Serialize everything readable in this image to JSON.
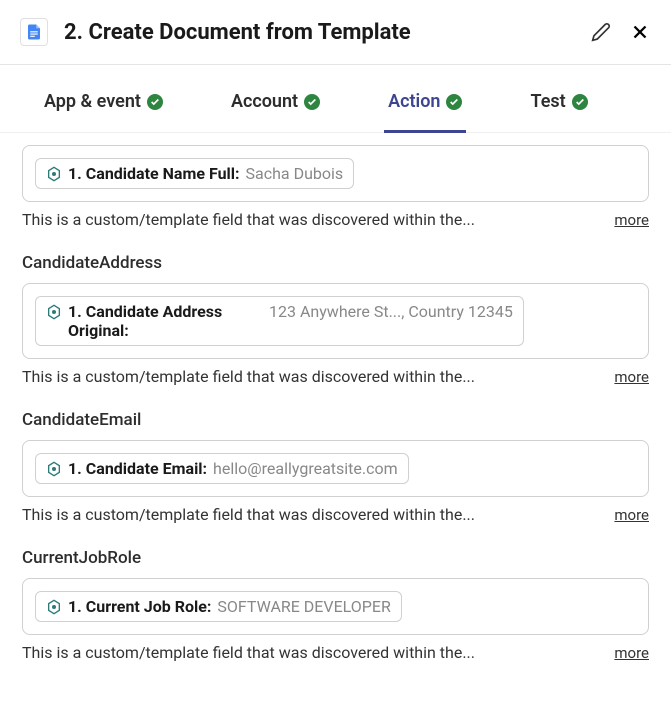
{
  "header": {
    "title": "2. Create Document from Template"
  },
  "tabs": [
    {
      "label": "App & event",
      "active": false
    },
    {
      "label": "Account",
      "active": false
    },
    {
      "label": "Action",
      "active": true
    },
    {
      "label": "Test",
      "active": false
    }
  ],
  "fields": [
    {
      "label": null,
      "pill_label": "1. Candidate Name Full:",
      "pill_value": "Sacha Dubois",
      "description": "This is a custom/template field that was discovered within the...",
      "more": "more"
    },
    {
      "label": "CandidateAddress",
      "pill_label": "1. Candidate Address Original:",
      "pill_value": "123 Anywhere St..., Country 12345",
      "description": "This is a custom/template field that was discovered within the...",
      "more": "more",
      "multiline": true
    },
    {
      "label": "CandidateEmail",
      "pill_label": "1. Candidate Email:",
      "pill_value": "hello@reallygreatsite.com",
      "description": "This is a custom/template field that was discovered within the...",
      "more": "more"
    },
    {
      "label": "CurrentJobRole",
      "pill_label": "1. Current Job Role:",
      "pill_value": "SOFTWARE DEVELOPER",
      "description": "This is a custom/template field that was discovered within the...",
      "more": "more"
    }
  ]
}
